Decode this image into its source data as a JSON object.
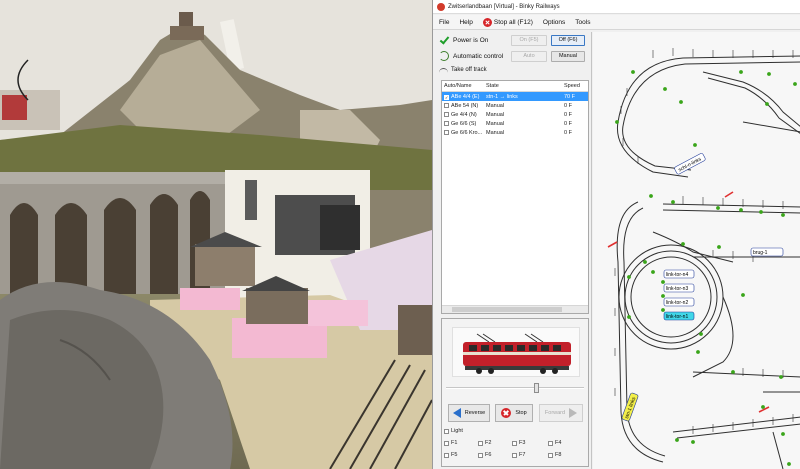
{
  "window": {
    "title": "Zwitserlandbaan [Virtual] - Binky Railways"
  },
  "menu": {
    "file": "File",
    "help": "Help",
    "stop_all": "Stop all (F12)",
    "options": "Options",
    "tools": "Tools"
  },
  "controls": {
    "power_label": "Power is On",
    "power_on_button": "On (F5)",
    "power_off_button": "Off (F6)",
    "auto_label": "Automatic control",
    "auto_button": "Auto",
    "manual_button": "Manual",
    "take_track": "Take off track"
  },
  "loco_list": {
    "columns": [
      "Auto/Name",
      "State",
      "Speed"
    ],
    "rows": [
      {
        "name": "ABe 4/4 (E)",
        "state": "stn-1 → links",
        "speed": "70 F",
        "checked": true,
        "selected": true
      },
      {
        "name": "ABe 54 (N)",
        "state": "Manual",
        "speed": "0 F",
        "checked": false,
        "selected": false
      },
      {
        "name": "Ge 4/4 (N)",
        "state": "Manual",
        "speed": "0 F",
        "checked": false,
        "selected": false
      },
      {
        "name": "Ge 6/6 (S)",
        "state": "Manual",
        "speed": "0 F",
        "checked": false,
        "selected": false
      },
      {
        "name": "Ge 6/6 Kro...",
        "state": "Manual",
        "speed": "0 F",
        "checked": false,
        "selected": false
      }
    ]
  },
  "loco_panel": {
    "speed_fraction": 0.66,
    "reverse_button": "Reverse",
    "stop_button": "Stop",
    "forward_button": "Forward",
    "light_label": "Light",
    "light_checked": true,
    "functions": [
      "F1",
      "F2",
      "F3",
      "F4",
      "F5",
      "F6",
      "F7",
      "F8"
    ]
  },
  "track_labels": {
    "label1": "schl-n-links",
    "label2": "brug-1",
    "label3": "link-tor-n4",
    "label4": "link-tor-n3",
    "label5": "link-tor-n2",
    "label6": "link-tor-n1",
    "label7": "stn-1 links"
  },
  "colors": {
    "accent_selection": "#3399ff",
    "power_check": "#1e9e2a",
    "stop_red": "#d6262a",
    "occupied_block": "#40d7e8",
    "sensor_green": "#3aa51a",
    "signal_red": "#e03030",
    "track_line": "#2f2f2f"
  }
}
